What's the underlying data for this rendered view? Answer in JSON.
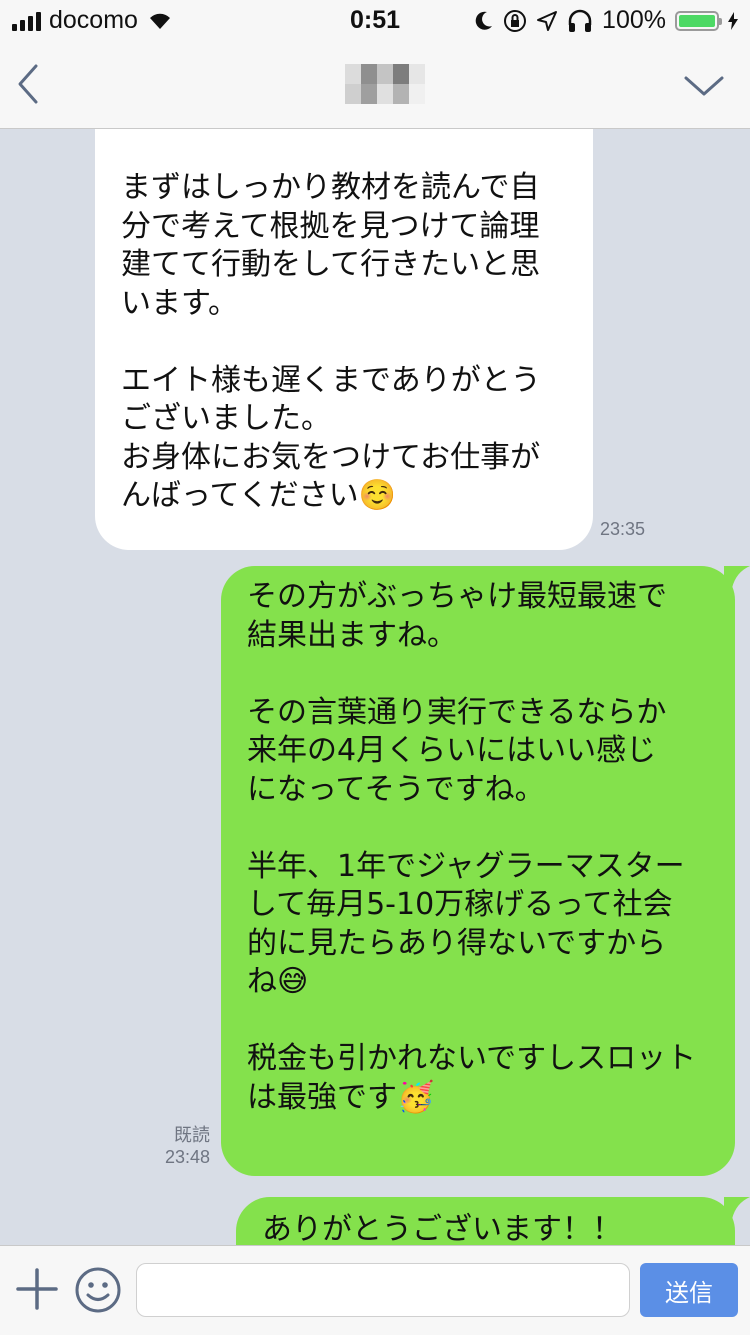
{
  "status_bar": {
    "carrier": "docomo",
    "time": "0:51",
    "battery_percent": "100%",
    "battery_level": 1.0,
    "icons": [
      "signal-bars-icon",
      "wifi-icon",
      "moon-icon",
      "orientation-lock-icon",
      "location-arrow-icon",
      "headphones-icon",
      "battery-icon",
      "charging-bolt-icon"
    ]
  },
  "header": {
    "back_icon": "chevron-left-icon",
    "title_obscured": true,
    "menu_icon": "chevron-down-icon"
  },
  "messages": [
    {
      "direction": "incoming",
      "text": "まずはしっかり教材を読んで自\n分で考えて根拠を見つけて論理\n建てて行動をして行きたいと思\nいます。\n\nエイト様も遅くまでありがとう\nございました。\nお身体にお気をつけてお仕事が\nんばってください☺️",
      "time": "23:35"
    },
    {
      "direction": "outgoing",
      "text": "その方がぶっちゃけ最短最速で\n結果出ますね。\n\nその言葉通り実行できるならか\n来年の4月くらいにはいい感じ\nになってそうですね。\n\n半年、1年でジャグラーマスター\nして毎月5-10万稼げるって社会\n的に見たらあり得ないですから\nね😅\n\n税金も引かれないですしスロット\nは最強です🥳",
      "read_label": "既読",
      "time": "23:48"
    },
    {
      "direction": "outgoing",
      "text": "ありがとうございます！！"
    }
  ],
  "input_bar": {
    "plus_icon": "plus-icon",
    "emoji_icon": "smiley-icon",
    "input_value": "",
    "send_label": "送信"
  },
  "colors": {
    "chat_background": "#d8dde6",
    "incoming_bubble": "#ffffff",
    "outgoing_bubble": "#84e14c",
    "send_button": "#5b8fe6",
    "bar_background": "#f7f7f7"
  }
}
